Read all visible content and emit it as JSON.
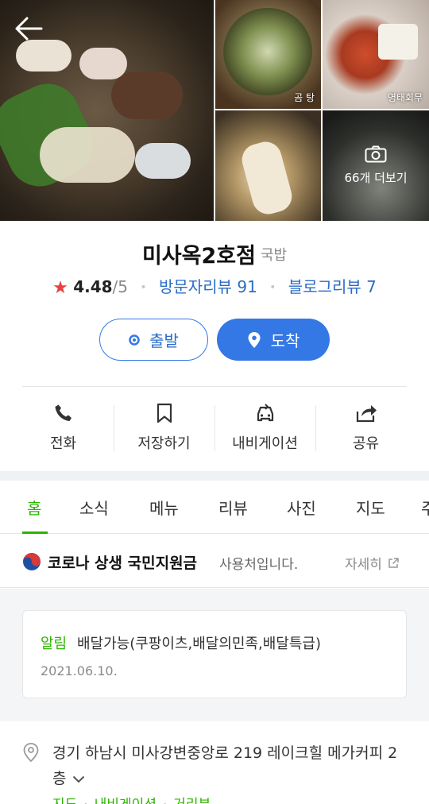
{
  "gallery": {
    "captions": [
      "곰 탕",
      "명태회무"
    ],
    "more_label": "66개 더보기"
  },
  "place": {
    "name": "미사옥2호점",
    "category": "국밥",
    "rating": "4.48",
    "rating_max": "/5",
    "visitor_reviews": "방문자리뷰 91",
    "blog_reviews": "블로그리뷰 7"
  },
  "buttons": {
    "start": "출발",
    "arrive": "도착"
  },
  "actions": [
    {
      "label": "전화",
      "icon": "phone-icon"
    },
    {
      "label": "저장하기",
      "icon": "bookmark-icon"
    },
    {
      "label": "내비게이션",
      "icon": "car-icon"
    },
    {
      "label": "공유",
      "icon": "share-icon"
    }
  ],
  "tabs": [
    "홈",
    "소식",
    "메뉴",
    "리뷰",
    "사진",
    "지도",
    "주"
  ],
  "banner": {
    "strong": "코로나 상생 국민지원금",
    "rest": "사용처입니다.",
    "detail": "자세히"
  },
  "notice": {
    "tag": "알림",
    "text": "배달가능(쿠팡이츠,배달의민족,배달특급)",
    "date": "2021.06.10."
  },
  "address": {
    "text": "경기 하남시 미사강변중앙로 219 레이크힐 메가커피 2층",
    "links": [
      "지도",
      "내비게이션",
      "거리뷰"
    ]
  },
  "colors": {
    "accent_blue": "#3478e5",
    "accent_green": "#2db400",
    "star_red": "#e8423f"
  }
}
